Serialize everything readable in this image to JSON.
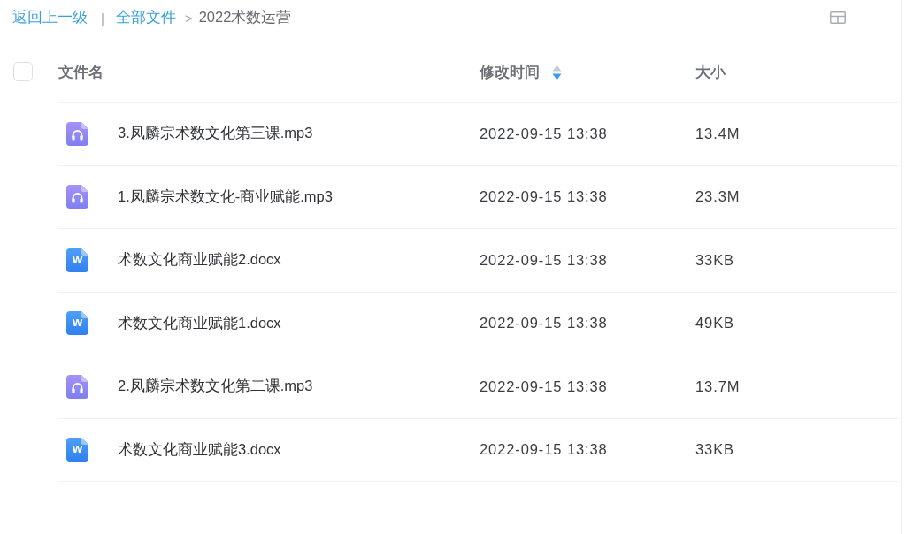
{
  "breadcrumb": {
    "back": "返回上一级",
    "divider": "|",
    "items": [
      {
        "label": "全部文件",
        "current": false
      },
      {
        "separator": ">",
        "label": "2022术数运营",
        "current": true
      }
    ]
  },
  "table": {
    "select_all": {
      "checked": false
    },
    "columns": [
      {
        "label": "文件名"
      },
      {
        "label": "修改时间",
        "sort_ascending": false,
        "sort_descending": true
      },
      {
        "label": "大小"
      }
    ],
    "rows": [
      {
        "kind": "audio",
        "name": "3.凤麟宗术数文化第三课.mp3",
        "modified": "2022-09-15 13:38",
        "size": "13.4M"
      },
      {
        "kind": "audio",
        "name": "1.凤麟宗术数文化-商业赋能.mp3",
        "modified": "2022-09-15 13:38",
        "size": "23.3M"
      },
      {
        "kind": "doc",
        "icon_letter": "W",
        "name": "术数文化商业赋能2.docx",
        "modified": "2022-09-15 13:38",
        "size": "33KB"
      },
      {
        "kind": "doc",
        "icon_letter": "W",
        "name": "术数文化商业赋能1.docx",
        "modified": "2022-09-15 13:38",
        "size": "49KB"
      },
      {
        "kind": "audio",
        "name": "2.凤麟宗术数文化第二课.mp3",
        "modified": "2022-09-15 13:38",
        "size": "13.7M"
      },
      {
        "kind": "doc",
        "icon_letter": "W",
        "name": "术数文化商业赋能3.docx",
        "modified": "2022-09-15 13:38",
        "size": "33KB"
      }
    ]
  }
}
